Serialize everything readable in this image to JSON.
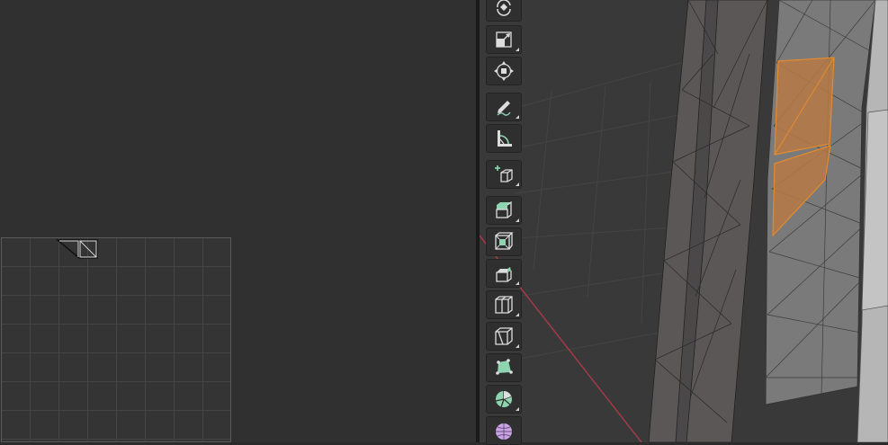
{
  "uv_editor": {
    "label": ""
  },
  "viewport": {
    "label": ""
  },
  "toolbar": {
    "tools": [
      {
        "icon": "rotate-icon",
        "has_submenu": false
      },
      {
        "icon": "scale-icon",
        "has_submenu": true
      },
      {
        "icon": "transform-icon",
        "has_submenu": false
      },
      {
        "icon": "annotate-icon",
        "has_submenu": true
      },
      {
        "icon": "measure-icon",
        "has_submenu": false
      },
      {
        "icon": "add-cube-icon",
        "has_submenu": true
      },
      {
        "icon": "extrude-region-icon",
        "has_submenu": true
      },
      {
        "icon": "inset-faces-icon",
        "has_submenu": false
      },
      {
        "icon": "bevel-icon",
        "has_submenu": true
      },
      {
        "icon": "loop-cut-icon",
        "has_submenu": true
      },
      {
        "icon": "knife-icon",
        "has_submenu": true
      },
      {
        "icon": "poly-build-icon",
        "has_submenu": false
      },
      {
        "icon": "spin-icon",
        "has_submenu": true
      },
      {
        "icon": "smooth-icon",
        "has_submenu": false
      }
    ]
  },
  "colors": {
    "selection": "#e58a2e",
    "tool_accent": "#8fd4b0",
    "smooth_accent": "#c9a6e3",
    "x_axis": "#a33a48"
  }
}
